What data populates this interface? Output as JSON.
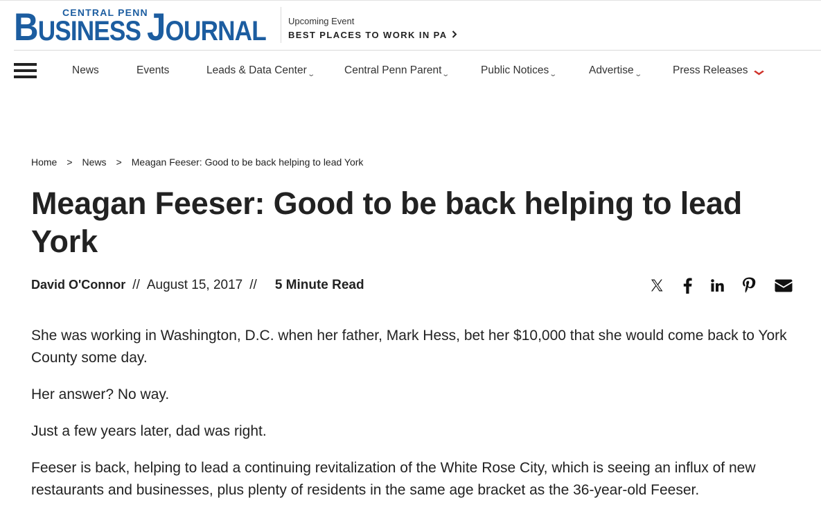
{
  "header": {
    "logo_small": "CENTRAL PENN",
    "logo_line_b": "B",
    "logo_line_usiness": "USINESS",
    "logo_line_j": "J",
    "logo_line_ournal": "OURNAL",
    "event_label": "Upcoming Event",
    "event_link": "BEST PLACES TO WORK IN PA"
  },
  "nav": {
    "items": [
      {
        "label": "News"
      },
      {
        "label": "Events"
      },
      {
        "label": "Leads & Data Center"
      },
      {
        "label": "Central Penn Parent"
      },
      {
        "label": "Public Notices"
      },
      {
        "label": "Advertise"
      },
      {
        "label": "Press Releases"
      }
    ],
    "caret": "⌄"
  },
  "breadcrumb": {
    "home": "Home",
    "news": "News",
    "current": "Meagan Feeser: Good to be back helping to lead York",
    "separator": ">"
  },
  "article": {
    "title": "Meagan Feeser: Good to be back helping to lead York",
    "author": "David O'Connor",
    "date": "August 15, 2017",
    "separator": "//",
    "read_time": "5 Minute Read",
    "paragraphs": [
      "She was working in Washington, D.C. when her father, Mark Hess, bet her $10,000 that she would come back to York County some day.",
      "Her answer? No way.",
      "Just a few years later, dad was right.",
      "Feeser is back, helping to lead a continuing revitalization of the White Rose City, which is seeing an influx of new restaurants and businesses, plus plenty of residents in the same age bracket as the 36-year-old Feeser."
    ]
  },
  "share": {
    "icons": [
      "x-icon",
      "facebook-icon",
      "linkedin-icon",
      "pinterest-icon",
      "email-icon"
    ]
  },
  "colors": {
    "brand": "#1c5da0",
    "text": "#222222",
    "accent_caret": "#d0342c"
  }
}
